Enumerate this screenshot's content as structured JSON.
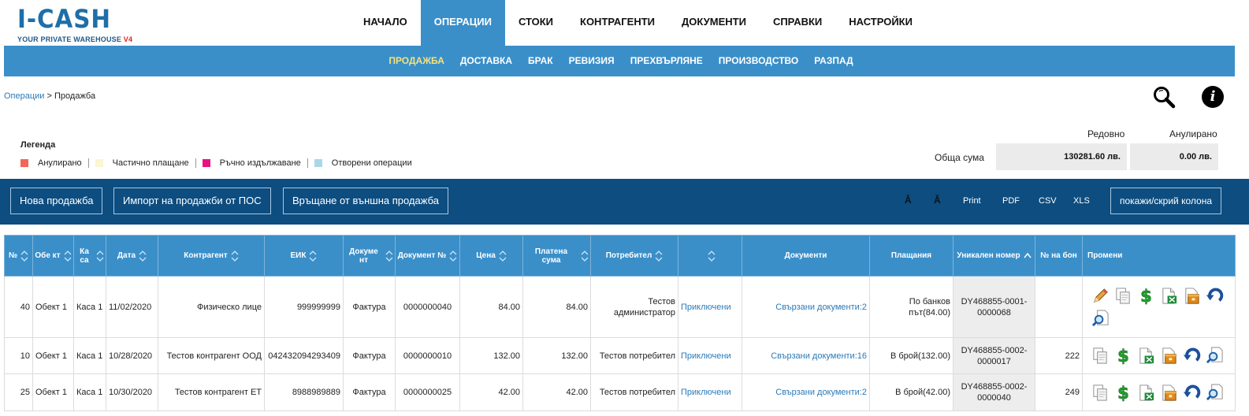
{
  "app": {
    "logo": "I-CASH",
    "tagline": "YOUR PRIVATE WAREHOUSE",
    "version": "V4"
  },
  "main_nav": [
    {
      "label": "НАЧАЛО",
      "active": false
    },
    {
      "label": "ОПЕРАЦИИ",
      "active": true
    },
    {
      "label": "СТОКИ",
      "active": false
    },
    {
      "label": "КОНТРАГЕНТИ",
      "active": false
    },
    {
      "label": "ДОКУМЕНТИ",
      "active": false
    },
    {
      "label": "СПРАВКИ",
      "active": false
    },
    {
      "label": "НАСТРОЙКИ",
      "active": false
    }
  ],
  "sub_nav": [
    {
      "label": "ПРОДАЖБА",
      "active": true
    },
    {
      "label": "ДОСТАВКА",
      "active": false
    },
    {
      "label": "БРАК",
      "active": false
    },
    {
      "label": "РЕВИЗИЯ",
      "active": false
    },
    {
      "label": "ПРЕХВЪРЛЯНЕ",
      "active": false
    },
    {
      "label": "ПРОИЗВОДСТВО",
      "active": false
    },
    {
      "label": "РАЗПАД",
      "active": false
    }
  ],
  "breadcrumb": {
    "parent": "Операции",
    "separator": " > ",
    "current": "Продажба"
  },
  "legend": {
    "title": "Легенда",
    "items": [
      {
        "label": "Анулирано",
        "color": "#f2665a"
      },
      {
        "label": "Частично плащане",
        "color": "#fbf6d3"
      },
      {
        "label": "Ръчно издължаване",
        "color": "#e8117f"
      },
      {
        "label": "Отворени операции",
        "color": "#a8d8e8"
      }
    ]
  },
  "totals": {
    "label": "Обща сума",
    "regular_header": "Редовно",
    "annulled_header": "Анулирано",
    "regular_value": "130281.60 лв.",
    "annulled_value": "0.00 лв."
  },
  "toolbar": {
    "new_sale": "Нова продажба",
    "import_pos": "Импорт на продажби от ПОС",
    "return_external": "Връщане от външна продажба",
    "font_increase": "Â",
    "font_decrease": "Ǎ",
    "print": "Print",
    "pdf": "PDF",
    "csv": "CSV",
    "xls": "XLS",
    "toggle_columns": "покажи/скрий колона"
  },
  "table": {
    "headers": [
      "№",
      "Обе кт",
      "Ка са",
      "Дата",
      "Контрагент",
      "ЕИК",
      "Докуме нт",
      "Документ №",
      "Цена",
      "Платена сума",
      "Потребител",
      "",
      "Документи",
      "Плащания",
      "Уникален номер",
      "№ на бон",
      "Промени"
    ],
    "rows": [
      {
        "num": "40",
        "object": "Обект 1",
        "till": "Каса 1",
        "date": "11/02/2020",
        "partner": "Физическо лице",
        "eik": "999999999",
        "doc_type": "Фактура",
        "doc_no": "0000000040",
        "price": "84.00",
        "paid": "84.00",
        "user": "Тестов администратор",
        "status": "Приключени",
        "documents": "Свързани документи:2",
        "payments": "По банков път(84.00)",
        "unique": "DY468855-0001-0000068",
        "receipt": ""
      },
      {
        "num": "10",
        "object": "Обект 1",
        "till": "Каса 1",
        "date": "10/28/2020",
        "partner": "Тестов контрагент ООД",
        "eik": "042432094293409",
        "doc_type": "Фактура",
        "doc_no": "0000000010",
        "price": "132.00",
        "paid": "132.00",
        "user": "Тестов потребител",
        "status": "Приключени",
        "documents": "Свързани документи:16",
        "payments": "В брой(132.00)",
        "unique": "DY468855-0002-0000017",
        "receipt": "222"
      },
      {
        "num": "25",
        "object": "Обект 1",
        "till": "Каса 1",
        "date": "10/30/2020",
        "partner": "Тестов контрагент ЕТ",
        "eik": "8988989889",
        "doc_type": "Фактура",
        "doc_no": "0000000025",
        "price": "42.00",
        "paid": "42.00",
        "user": "Тестов потребител",
        "status": "Приключени",
        "documents": "Свързани документи:2",
        "payments": "В брой(42.00)",
        "unique": "DY468855-0002-0000040",
        "receipt": "249"
      }
    ],
    "row_actions": [
      [
        "pencil-icon",
        "copy-icon",
        "dollar-icon",
        "excel-export-icon",
        "archive-icon",
        "undo-arrow-icon",
        "magnifier-icon"
      ],
      [
        "copy-icon",
        "dollar-icon",
        "excel-export-icon",
        "archive-icon",
        "undo-arrow-icon",
        "magnifier-icon"
      ],
      [
        "copy-icon",
        "dollar-icon",
        "excel-export-icon",
        "archive-icon",
        "undo-arrow-icon",
        "magnifier-icon"
      ]
    ]
  },
  "colors": {
    "brand": "#1e6fa8",
    "nav_active": "#3a8fc9",
    "toolbar": "#0d4d80",
    "link": "#2a7ab8"
  }
}
